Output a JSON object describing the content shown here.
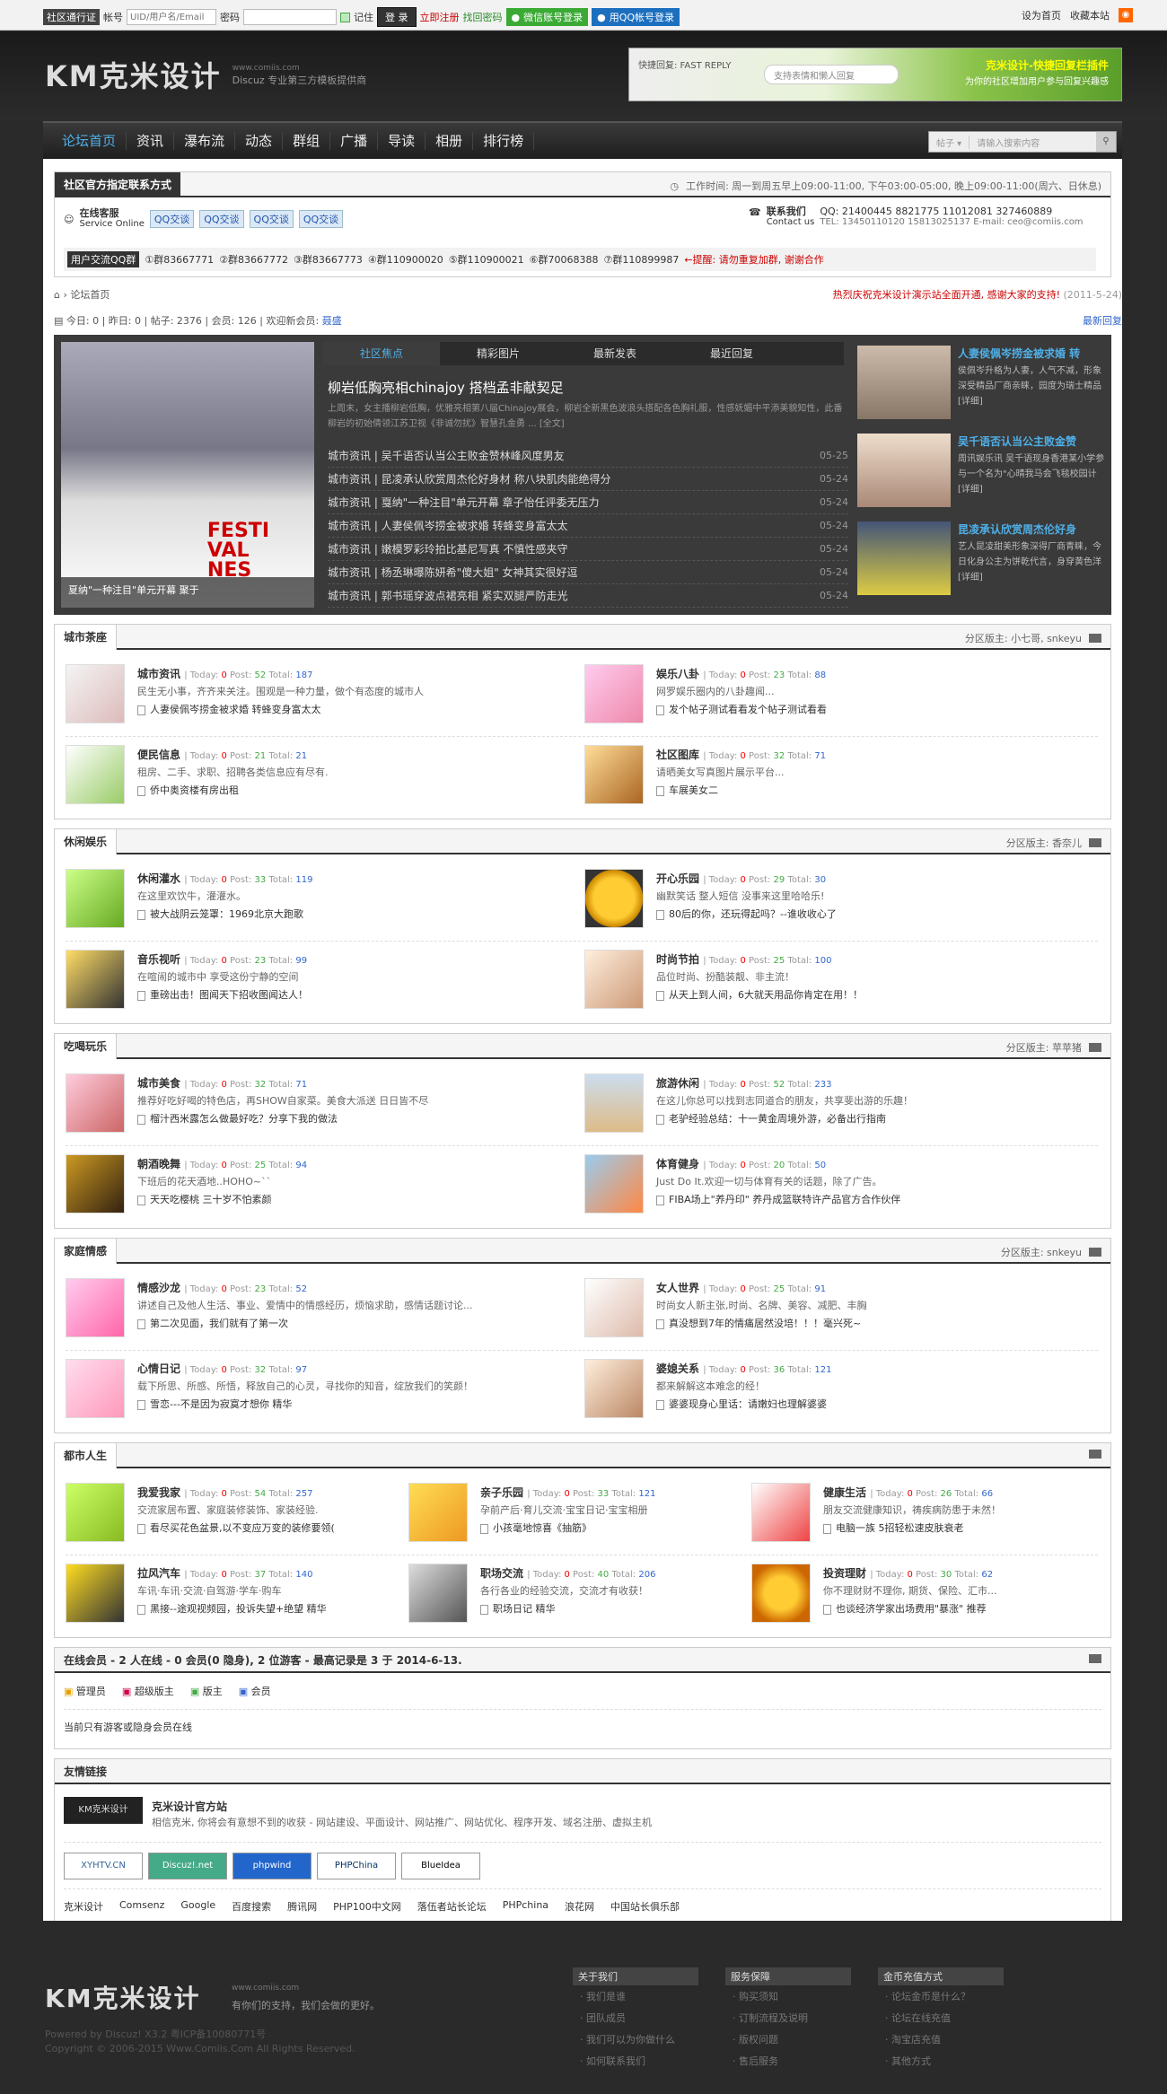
{
  "topbar": {
    "passport": "社区通行证",
    "account_label": "帐号",
    "account_placeholder": "UID/用户名/Email",
    "password_label": "密码",
    "remember": "记住",
    "login": "登 录",
    "register": "立即注册",
    "find_pwd": "找回密码",
    "wechat_login": "微信账号登录",
    "qq_login": "用QQ帐号登录",
    "set_home": "设为首页",
    "bookmark": "收藏本站"
  },
  "header": {
    "logo_text": "KM克米设计",
    "site_url": "www.comiis.com",
    "slogan": "Discuz 专业第三方模板提供商",
    "banner_left": "快捷回复: FAST REPLY",
    "banner_input": "支持表情和懒人回复",
    "banner_title": "克米设计-快捷回复栏插件",
    "banner_sub": "为你的社区增加用户参与回复兴趣感"
  },
  "nav": {
    "items": [
      "论坛首页",
      "资讯",
      "瀑布流",
      "动态",
      "群组",
      "广播",
      "导读",
      "相册",
      "排行榜"
    ],
    "search_type": "帖子",
    "search_placeholder": "请输入搜索内容"
  },
  "contact": {
    "title": "社区官方指定联系方式",
    "hours": "工作时间: 周一到周五早上09:00-11:00, 下午03:00-05:00, 晚上09:00-11:00(周六、日休息)",
    "service": "在线客服",
    "service_sub": "Service Online",
    "qq_btn": "QQ交谈",
    "contact_us": "联系我们",
    "contact_us_en": "Contact us",
    "qq_nums": "QQ: 21400445  8821775  11012081  327460889",
    "tel": "TEL: 13450110120  15813025137  E-mail: ceo@comiis.com",
    "group_label": "用户交流QQ群",
    "groups": [
      "①群83667771",
      "②群83667772",
      "③群83667773",
      "④群110900020",
      "⑤群110900021",
      "⑥群70068388",
      "⑦群110899987"
    ],
    "reminder": "←提醒: 请勿重复加群, 谢谢合作"
  },
  "crumb": {
    "home": "论坛首页",
    "notice": "热烈庆祝克米设计演示站全面开通, 感谢大家的支持!",
    "notice_date": "(2011-5-24)",
    "stats": "今日: 0 | 昨日: 0 | 帖子: 2376 | 会员: 126 | 欢迎新会员:",
    "new_member": "聂盛",
    "latest": "最新回复"
  },
  "slider": {
    "caption": "夏纳\"一种注目\"单元开幕 聚于",
    "tabs": [
      "社区焦点",
      "精彩图片",
      "最新发表",
      "最近回复"
    ],
    "headline": "柳岩低胸亮相chinajoy 搭档孟非献契足",
    "summary": "上周末，女主播柳岩低胸，优雅亮相第八届Chinajoy展会，柳岩全新黑色波浪头搭配各色胸礼服，性感妩媚中平添美貌知性，此番柳岩的初始倩领江苏卫视《非诚勿扰》智慧孔金勇 ... [全文]",
    "news": [
      {
        "t": "城市资讯 | 吴千语否认当公主败金赞林峰风度男友",
        "d": "05-25"
      },
      {
        "t": "城市资讯 | 昆凌承认欣赏周杰伦好身材 称八块肌肉能绝得分",
        "d": "05-24"
      },
      {
        "t": "城市资讯 | 戛纳\"一种注目\"单元开幕 章子怡任评委无压力",
        "d": "05-24"
      },
      {
        "t": "城市资讯 | 人妻侯佩岑捞金被求婚 转蜂变身富太太",
        "d": "05-24"
      },
      {
        "t": "城市资讯 | 嫩模罗彩玲拍比基尼写真 不慎性感夹守",
        "d": "05-24"
      },
      {
        "t": "城市资讯 | 杨丞琳曝陈妍希\"傻大姐\" 女神其实很好逗",
        "d": "05-24"
      },
      {
        "t": "城市资讯 | 郭书瑶穿波点裙亮相 紧实双腿严防走光",
        "d": "05-24"
      }
    ],
    "side": [
      {
        "t": "人妻侯佩岑捞金被求婚 转",
        "d": "侯佩岑升格为人妻，人气不减，形象深受精品厂商亲睐，园度为瑞士精品 [详细]"
      },
      {
        "t": "吴千语否认当公主败金赞",
        "d": "周讯娱乐讯 吴千语现身香港某小学参与一个名为\"心晴我马会飞毯校园计 [详细]"
      },
      {
        "t": "昆凌承认欣赏周杰伦好身",
        "d": "艺人昆凌甜美形象深得厂商青睐，今日化身公主为饼乾代言，身穿黄色洋 [详细]"
      }
    ]
  },
  "sections": [
    {
      "title": "城市茶座",
      "mods": "分区版主: 小七哥, snkeyu",
      "forums": [
        {
          "name": "城市资讯",
          "today": "0",
          "post": "52",
          "total": "187",
          "desc": "民生无小事，齐齐来关注。围观是一种力量，做个有态度的城市人",
          "last": "人妻侯佩岑捞金被求婚 转蜂变身富太太"
        },
        {
          "name": "娱乐八卦",
          "today": "0",
          "post": "23",
          "total": "88",
          "desc": "网罗娱乐圈内的八卦趣闻...",
          "last": "发个帖子测试看看发个帖子测试看看"
        },
        {
          "name": "便民信息",
          "today": "0",
          "post": "21",
          "total": "21",
          "desc": "租房、二手、求职、招聘各类信息应有尽有.",
          "last": "侨中奥资楼有房出租"
        },
        {
          "name": "社区图库",
          "today": "0",
          "post": "32",
          "total": "71",
          "desc": "请晒美女写真图片展示平台...",
          "last": "车展美女二"
        }
      ]
    },
    {
      "title": "休闲娱乐",
      "mods": "分区版主: 香奈儿",
      "forums": [
        {
          "name": "休闲灌水",
          "today": "0",
          "post": "33",
          "total": "119",
          "desc": "在这里欢饮牛，灌灌水。",
          "last": "被大战阴云笼罩：1969北京大跑歌"
        },
        {
          "name": "开心乐园",
          "today": "0",
          "post": "29",
          "total": "30",
          "desc": "幽默笑话 整人短信 没事来这里哈哈乐!",
          "last": "80后的你，还玩得起吗？--谁收收心了"
        },
        {
          "name": "音乐视听",
          "today": "0",
          "post": "23",
          "total": "99",
          "desc": "在喧闹的城市中 享受这份宁静的空间",
          "last": "重磅出击！图闻天下招收图闻达人！"
        },
        {
          "name": "时尚节拍",
          "today": "0",
          "post": "25",
          "total": "100",
          "desc": "品位时尚、扮酷装靓、非主流！",
          "last": "从天上到人间，6大就天用品你肯定在用！！"
        }
      ]
    },
    {
      "title": "吃喝玩乐",
      "mods": "分区版主: 苹苹猪",
      "forums": [
        {
          "name": "城市美食",
          "today": "0",
          "post": "32",
          "total": "71",
          "desc": "推荐好吃好喝的特色店，再SHOW自家菜。美食大派送  日日皆不尽",
          "last": "榴汁西米露怎么做最好吃？分享下我的做法"
        },
        {
          "name": "旅游休闲",
          "today": "0",
          "post": "52",
          "total": "233",
          "desc": "在这儿你总可以找到志同道合的朋友，共享斐出游的乐趣！",
          "last": "老驴经验总结：十一黄金周境外游，必备出行指南"
        },
        {
          "name": "朝酒晚舞",
          "today": "0",
          "post": "25",
          "total": "94",
          "desc": "下班后的花天酒地..HOHO~``",
          "last": "天天吃樱桃 三十岁不怕素颜"
        },
        {
          "name": "体育健身",
          "today": "0",
          "post": "20",
          "total": "50",
          "desc": "Just Do It.欢迎一切与体育有关的话题，除了广告。",
          "last": "FIBA场上\"养丹印\" 养丹成篮联特许产品官方合作伙伴"
        }
      ]
    },
    {
      "title": "家庭情感",
      "mods": "分区版主: snkeyu",
      "forums": [
        {
          "name": "情感沙龙",
          "today": "0",
          "post": "23",
          "total": "52",
          "desc": "讲述自己及他人生活、事业、爱情中的情感经历，烦恼求助，感情话题讨论...",
          "last": "第二次见面，我们就有了第一次"
        },
        {
          "name": "女人世界",
          "today": "0",
          "post": "25",
          "total": "91",
          "desc": "时尚女人新主张,时尚、名牌、美容、减肥、丰胸",
          "last": "真没想到7年的情痛居然没培！！！毫兴死~"
        },
        {
          "name": "心情日记",
          "today": "0",
          "post": "32",
          "total": "97",
          "desc": "载下所思、所感、所悟，释放自己的心灵，寻找你的知音，绽放我们的笑颜！",
          "last": "雪恋---不是因为寂寞才想你 精华"
        },
        {
          "name": "婆媳关系",
          "today": "0",
          "post": "36",
          "total": "121",
          "desc": "都来解解这本难念的经！",
          "last": "婆婆现身心里话：请嫩妇也理解婆婆"
        }
      ]
    }
  ],
  "city": {
    "title": "都市人生",
    "forums": [
      {
        "name": "我爱我家",
        "today": "0",
        "post": "54",
        "total": "257",
        "desc": "交流家居布置、家庭装修装饰、家装经验.",
        "last": "看尽买花色盆景,以不变应万变的装修要领("
      },
      {
        "name": "亲子乐园",
        "today": "0",
        "post": "33",
        "total": "121",
        "desc": "孕前产后·育儿交流·宝宝日记·宝宝相册",
        "last": "小孩毫地惊喜《抽筋》"
      },
      {
        "name": "健康生活",
        "today": "0",
        "post": "26",
        "total": "66",
        "desc": "朋友交流健康知识，祷疾病防患于未然！",
        "last": "电脑一族 5招轻松速皮肤衰老"
      },
      {
        "name": "拉风汽车",
        "today": "0",
        "post": "37",
        "total": "140",
        "desc": "车讯·车讯·交流·自驾游·学车·购车",
        "last": "黑接--途观视频园，投诉失望+绝望 精华"
      },
      {
        "name": "职场交流",
        "today": "0",
        "post": "40",
        "total": "206",
        "desc": "各行各业的经验交流，交流才有收获！",
        "last": "职场日记 精华"
      },
      {
        "name": "投资理财",
        "today": "0",
        "post": "30",
        "total": "62",
        "desc": "你不理财财不理你, 期货、保险、汇市...",
        "last": "也谈经济学家出场费用\"暴涨\" 推荐"
      }
    ]
  },
  "online": {
    "title": "在线会员 - 2 人在线 - 0 会员(0 隐身), 2 位游客 - 最高记录是 3 于 2014-6-13.",
    "legend": [
      "管理员",
      "超级版主",
      "版主",
      "会员"
    ],
    "legend_colors": [
      "#e6a100",
      "#c04",
      "#4a4",
      "#36c"
    ],
    "note": "当前只有游客或隐身会员在线"
  },
  "friends": {
    "title": "友情链接",
    "site_name": "克米设计官方站",
    "site_desc": "相信克米, 你将会有意想不到的收获 - 网站建设、平面设计、网站推广、网站优化、程序开发、域名注册、虚拟主机",
    "logos": [
      "XYHTV.CN",
      "Discuz!.net",
      "phpwind",
      "PHPChina",
      "BlueIdea"
    ],
    "links": [
      "克米设计",
      "Comsenz",
      "Google",
      "百度搜索",
      "腾讯网",
      "PHP100中文网",
      "落伍者站长论坛",
      "PHPchina",
      "浪花网",
      "中国站长俱乐部"
    ]
  },
  "footer": {
    "logo": "KM克米设计",
    "site": "www.comiis.com",
    "slogan": "有你们的支持，我们会做的更好。",
    "powered": "Powered by Discuz! X3.2 粤ICP备10080771号",
    "copyright": "Copyright © 2006-2015 Www.Comiis.Com All Rights Reserved.",
    "cols": [
      {
        "h": "关于我们",
        "items": [
          "我们是谁",
          "团队成员",
          "我们可以为你做什么",
          "如何联系我们"
        ]
      },
      {
        "h": "服务保障",
        "items": [
          "购买须知",
          "订制流程及说明",
          "版权问题",
          "售后服务"
        ]
      },
      {
        "h": "金币充值方式",
        "items": [
          "论坛金币是什么？",
          "论坛在线充值",
          "淘宝店充值",
          "其他方式"
        ]
      }
    ]
  }
}
